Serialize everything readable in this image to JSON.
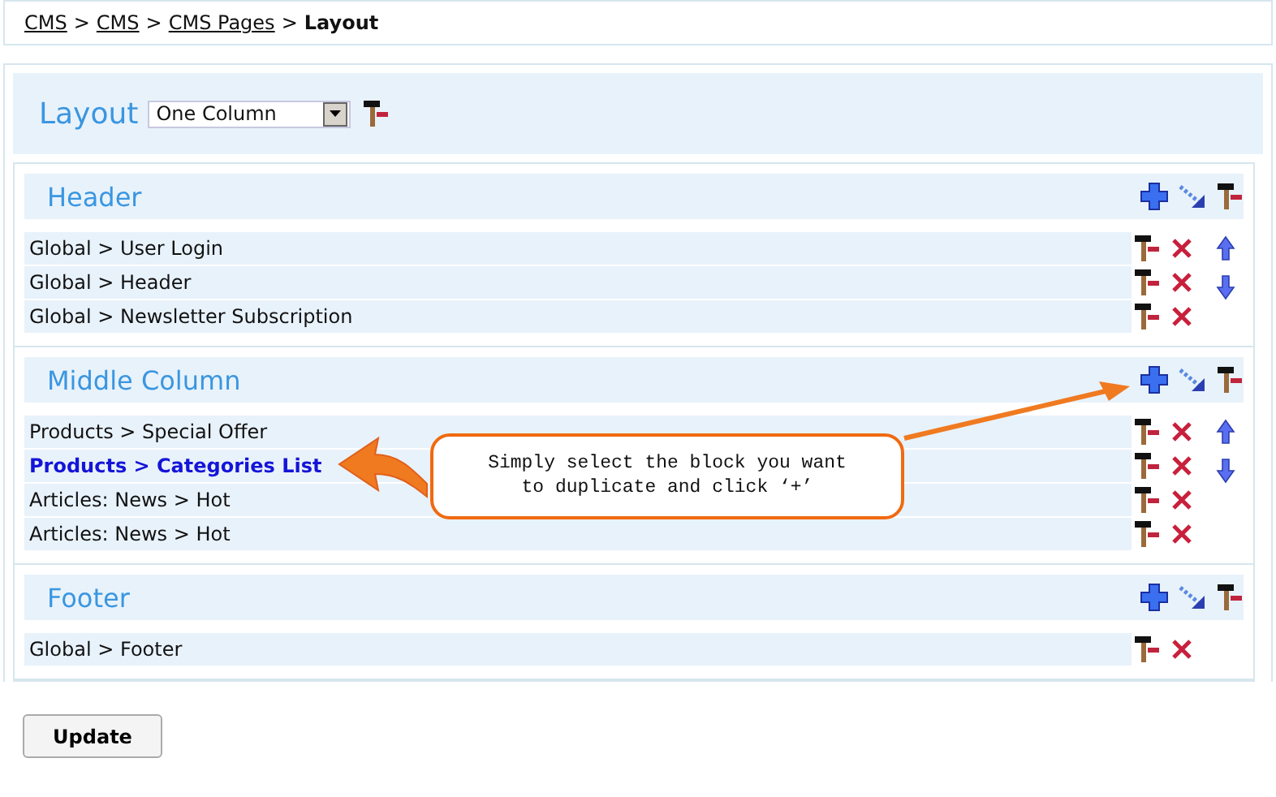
{
  "breadcrumb": {
    "links": [
      "CMS",
      "CMS",
      "CMS Pages"
    ],
    "separator": ">",
    "current": "Layout"
  },
  "layout": {
    "label": "Layout",
    "select_value": "One Column"
  },
  "sections": [
    {
      "title": "Header",
      "reorder": true,
      "rows": [
        {
          "text": "Global > User Login",
          "selected": false
        },
        {
          "text": "Global > Header",
          "selected": false
        },
        {
          "text": "Global > Newsletter Subscription",
          "selected": false
        }
      ]
    },
    {
      "title": "Middle Column",
      "reorder": true,
      "rows": [
        {
          "text": "Products > Special Offer",
          "selected": false
        },
        {
          "text": "Products > Categories List",
          "selected": true
        },
        {
          "text": "Articles: News > Hot",
          "selected": false
        },
        {
          "text": "Articles: News > Hot",
          "selected": false
        }
      ]
    },
    {
      "title": "Footer",
      "reorder": false,
      "rows": [
        {
          "text": "Global > Footer",
          "selected": false
        }
      ]
    }
  ],
  "callout": {
    "text": "Simply select the block you want to duplicate and click ‘+’"
  },
  "update_button": "Update"
}
